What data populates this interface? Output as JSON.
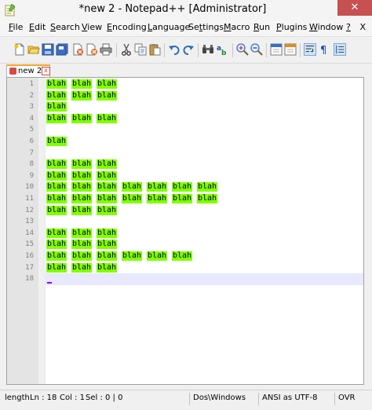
{
  "window": {
    "title": "*new  2 - Notepad++ [Administrator]",
    "close_glyph": "✕"
  },
  "menu": [
    {
      "label": "File",
      "ul": "F",
      "rest": "ile"
    },
    {
      "label": "Edit",
      "ul": "E",
      "rest": "dit"
    },
    {
      "label": "Search",
      "ul": "S",
      "rest": "earch"
    },
    {
      "label": "View",
      "ul": "V",
      "rest": "iew"
    },
    {
      "label": "Encoding",
      "ul": "E",
      "rest": "ncoding",
      "ul_pos": "first"
    },
    {
      "label": "Language",
      "ul": "L",
      "rest": "anguage"
    },
    {
      "label": "Settings",
      "ul": "S",
      "rest": "ettings",
      "ul_index": 2
    },
    {
      "label": "Macro",
      "ul": "M",
      "rest": "acro"
    },
    {
      "label": "Run",
      "ul": "R",
      "rest": "un"
    },
    {
      "label": "Plugins",
      "ul": "P",
      "rest": "lugins"
    },
    {
      "label": "Window",
      "ul": "W",
      "rest": "indow"
    },
    {
      "label": "?",
      "ul": "?",
      "rest": ""
    }
  ],
  "menu_close": "X",
  "tab": {
    "label": "new  2",
    "close": "x"
  },
  "lines": [
    {
      "n": "1",
      "words": 3
    },
    {
      "n": "2",
      "words": 3
    },
    {
      "n": "3",
      "words": 1
    },
    {
      "n": "4",
      "words": 3
    },
    {
      "n": "5",
      "words": 0
    },
    {
      "n": "6",
      "words": 1
    },
    {
      "n": "7",
      "words": 0
    },
    {
      "n": "8",
      "words": 3
    },
    {
      "n": "9",
      "words": 3
    },
    {
      "n": "10",
      "words": 7
    },
    {
      "n": "11",
      "words": 7
    },
    {
      "n": "12",
      "words": 3
    },
    {
      "n": "13",
      "words": 0
    },
    {
      "n": "14",
      "words": 3
    },
    {
      "n": "15",
      "words": 3
    },
    {
      "n": "16",
      "words": 6
    },
    {
      "n": "17",
      "words": 3
    },
    {
      "n": "18",
      "words": 0
    }
  ],
  "word_text": "blah",
  "highlight_color": "#80ff00",
  "current_line": "18",
  "status": {
    "length": "length",
    "ln": "Ln : 18",
    "col": "Col : 1",
    "sel": "Sel : 0 | 0",
    "eol": "Dos\\Windows",
    "encoding": "ANSI as UTF-8",
    "mode": "OVR"
  }
}
